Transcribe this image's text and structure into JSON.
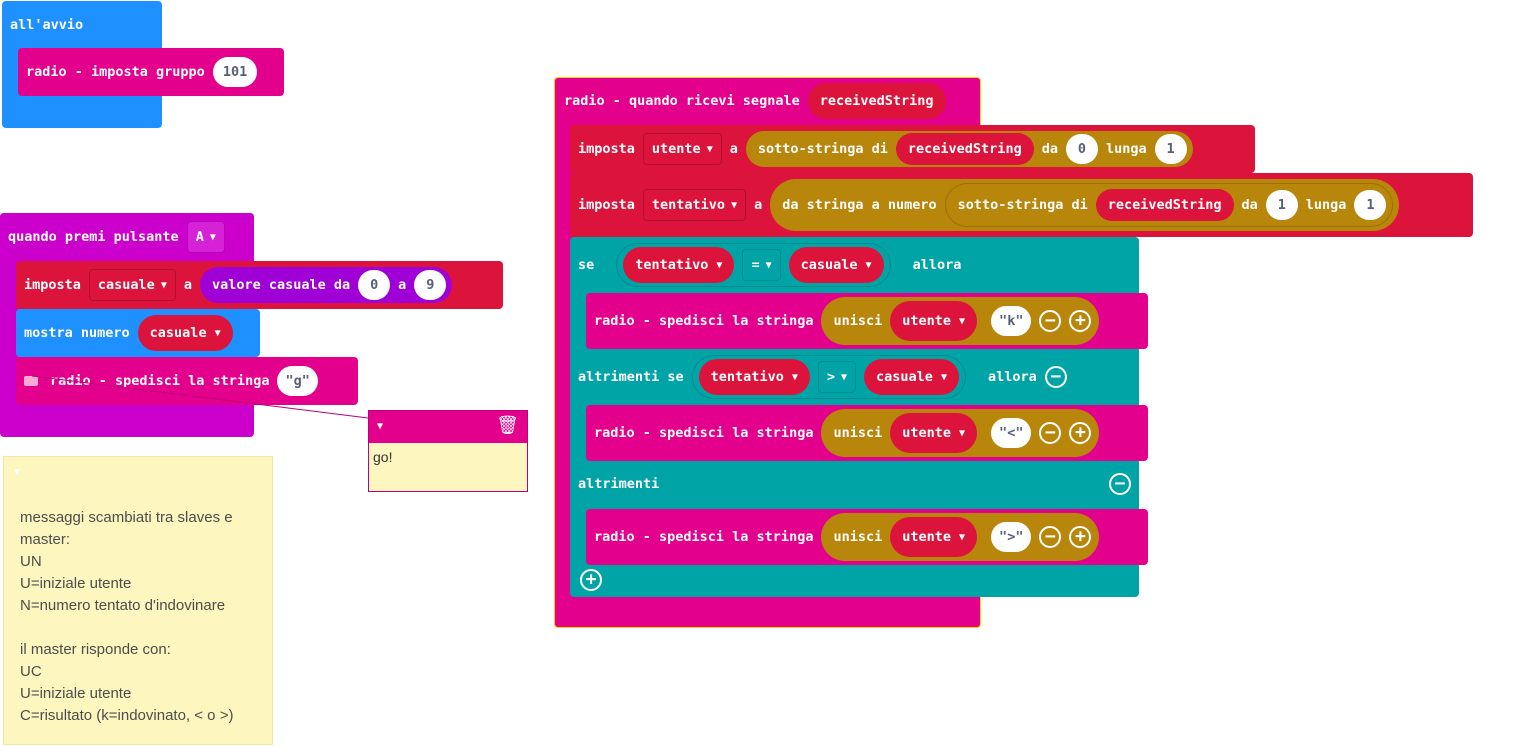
{
  "on_start": {
    "title": "all'avvio",
    "set_group_label": "radio - imposta gruppo",
    "group_value": "101"
  },
  "on_button": {
    "title": "quando premi pulsante",
    "button_value": "A",
    "set_label": "imposta",
    "var_name": "casuale",
    "to_label": "a",
    "random_label": "valore casuale da",
    "random_from": "0",
    "random_to_label": "a",
    "random_to": "9",
    "show_number_label": "mostra numero",
    "show_var": "casuale",
    "send_label": "radio - spedisci la stringa",
    "send_value": "g"
  },
  "comment_popup": {
    "text": "go!"
  },
  "workspace_note": {
    "lines": [
      "messaggi scambiati tra slaves e",
      "master:",
      "UN",
      "U=iniziale utente",
      "N=numero tentato d'indovinare",
      "",
      "il master risponde con:",
      "UC",
      "U=iniziale utente",
      "C=risultato (k=indovinato, < o >)"
    ]
  },
  "on_receive": {
    "title": "radio - quando ricevi segnale",
    "param": "receivedString",
    "set1": {
      "set_label": "imposta",
      "var": "utente",
      "to_label": "a",
      "substr_label": "sotto-stringa di",
      "src": "receivedString",
      "from_label": "da",
      "from": "0",
      "len_label": "lunga",
      "len": "1"
    },
    "set2": {
      "set_label": "imposta",
      "var": "tentativo",
      "to_label": "a",
      "parse_label": "da stringa a numero",
      "substr_label": "sotto-stringa di",
      "src": "receivedString",
      "from_label": "da",
      "from": "1",
      "len_label": "lunga",
      "len": "1"
    },
    "if_label": "se",
    "cond1": {
      "left": "tentativo",
      "op": "=",
      "right": "casuale"
    },
    "then_label": "allora",
    "send_label": "radio - spedisci la stringa",
    "join_label": "unisci",
    "join_var": "utente",
    "send1_value": "k",
    "elseif_label": "altrimenti se",
    "cond2": {
      "left": "tentativo",
      "op": ">",
      "right": "casuale"
    },
    "send2_value": "<",
    "else_label": "altrimenti",
    "send3_value": ">"
  },
  "colors": {
    "events": "#e3008c",
    "radio": "#e3008c",
    "variables": "#dc143c",
    "text": "#b8860b",
    "logic": "#00a4a6",
    "math": "#9f00d6",
    "basic": "#1e90ff",
    "note": "#fdf6bf"
  }
}
